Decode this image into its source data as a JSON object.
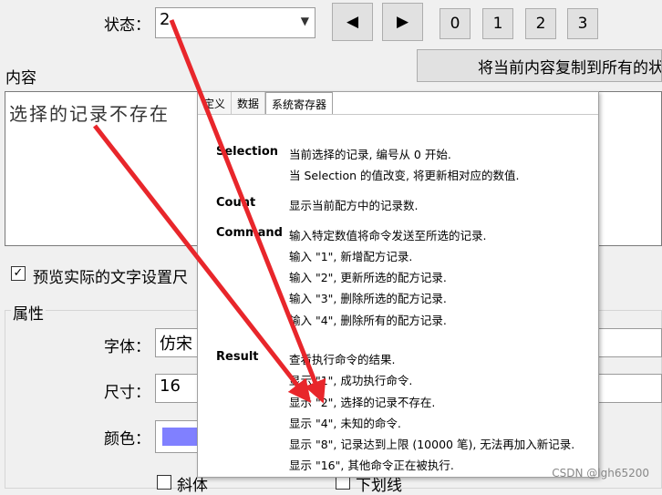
{
  "state": {
    "label": "状态：",
    "value": "2"
  },
  "nav": {
    "prev": "◀",
    "next": "▶",
    "pages": [
      "0",
      "1",
      "2",
      "3"
    ]
  },
  "content": {
    "label": "内容",
    "copy_button": "将当前内容复制到所有的状",
    "text": "选择的记录不存在"
  },
  "preview_checkbox": {
    "checked_mark": "✓",
    "label": "预览实际的文字设置尺"
  },
  "properties": {
    "title": "属性",
    "font_label": "字体：",
    "font_value": "仿宋",
    "size_label": "尺寸：",
    "size_value": "16",
    "color_label": "颜色：",
    "color_value": "#8080ff",
    "italic_label": "斜体",
    "underline_label": "下划线"
  },
  "tooltip": {
    "tabs": [
      "定义",
      "数据",
      "系统寄存器"
    ],
    "sections": [
      {
        "term": "Selection",
        "lines": [
          "当前选择的记录, 编号从 0 开始.",
          "当 Selection 的值改变, 将更新相对应的数值."
        ]
      },
      {
        "term": "Count",
        "lines": [
          "显示当前配方中的记录数."
        ]
      },
      {
        "term": "Command",
        "lines": [
          "输入特定数值将命令发送至所选的记录.",
          "输入 \"1\", 新增配方记录.",
          "输入 \"2\", 更新所选的配方记录.",
          "输入 \"3\", 删除所选的配方记录.",
          "输入 \"4\", 删除所有的配方记录."
        ]
      },
      {
        "term": "Result",
        "lines": [
          "查看执行命令的结果.",
          "显示 \"1\", 成功执行命令.",
          "显示 \"2\", 选择的记录不存在.",
          "显示 \"4\", 未知的命令.",
          "显示 \"8\", 记录达到上限 (10000 笔), 无法再加入新记录.",
          "显示 \"16\", 其他命令正在被执行."
        ]
      }
    ]
  },
  "watermark": "CSDN @lgh65200",
  "annotation_color": "#e8262b"
}
